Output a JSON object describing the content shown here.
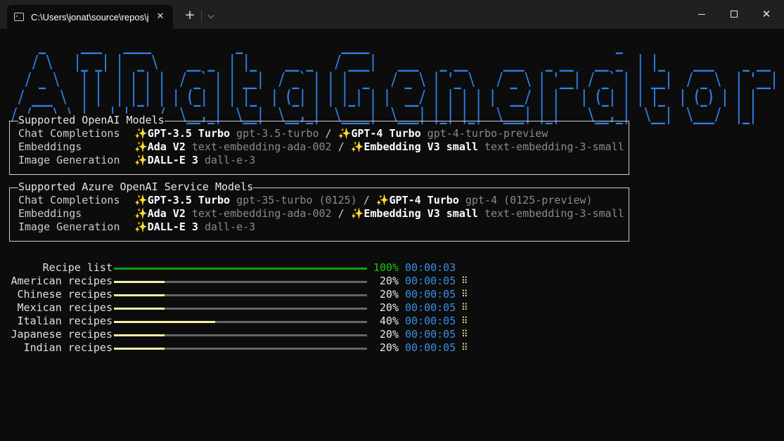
{
  "window": {
    "tab_title": "C:\\Users\\jonat\\source\\repos\\j",
    "tab_icon": "terminal-icon",
    "close_glyph": "✕",
    "new_tab_glyph": "+",
    "dropdown_glyph": "⌵",
    "min_glyph": "",
    "max_glyph": "",
    "win_close_glyph": "✕"
  },
  "banner": {
    "ascii": "    _     ___   ____            _              ____                                   _                 \n   / \\   |_ _| |  _ \\    __ _  | |_    __ _   / ___|   ___   _ __     ___   _ __   __ _  | |_    ___    _ __ \n  / _ \\   | |  | | | |  / _` | | __|  / _` | | |  _   / _ \\ | '_ \\   / _ \\ | '__| / _` | | __|  / _ \\  | '__|\n / ___ \\  | |  | |_| | | (_| | | |_  | (_| | | |_| | |  __/ | | | | |  __/ | |   | (_| | | |_  | (_) | | |   \n/_/   \\_\\ |___| |____/  \\__,_|  \\__|  \\__,_|  \\____|  \\___| |_| |_|  \\___| |_|    \\__,_|  \\__|  \\___/  |_|   ",
    "color": "#2f7fe6"
  },
  "openai_panel": {
    "title": "Supported OpenAI Models",
    "rows": [
      {
        "label": "Chat Completions",
        "items": [
          {
            "icon": "✨",
            "name": "GPT-3.5 Turbo",
            "id": "gpt-3.5-turbo"
          },
          {
            "icon": "✨",
            "name": "GPT-4 Turbo",
            "id": "gpt-4-turbo-preview"
          }
        ]
      },
      {
        "label": "Embeddings",
        "items": [
          {
            "icon": "✨",
            "name": "Ada V2",
            "id": "text-embedding-ada-002"
          },
          {
            "icon": "✨",
            "name": "Embedding V3 small",
            "id": "text-embedding-3-small"
          }
        ]
      },
      {
        "label": "Image Generation",
        "items": [
          {
            "icon": "✨",
            "name": "DALL-E 3",
            "id": "dall-e-3"
          }
        ]
      }
    ]
  },
  "azure_panel": {
    "title": "Supported Azure OpenAI Service Models",
    "rows": [
      {
        "label": "Chat Completions",
        "items": [
          {
            "icon": "✨",
            "name": "GPT-3.5 Turbo",
            "id": "gpt-35-turbo (0125)"
          },
          {
            "icon": "✨",
            "name": "GPT-4 Turbo",
            "id": "gpt-4 (0125-preview)"
          }
        ]
      },
      {
        "label": "Embeddings",
        "items": [
          {
            "icon": "✨",
            "name": "Ada V2",
            "id": "text-embedding-ada-002"
          },
          {
            "icon": "✨",
            "name": "Embedding V3 small",
            "id": "text-embedding-3-small"
          }
        ]
      },
      {
        "label": "Image Generation",
        "items": [
          {
            "icon": "✨",
            "name": "DALL-E 3",
            "id": "dall-e-3"
          }
        ]
      }
    ]
  },
  "separator": " / ",
  "progress": [
    {
      "label": "Recipe list",
      "percent": 100,
      "pct_text": "100%",
      "time": "00:00:03",
      "spinner": "",
      "color": "#13a10e",
      "pct_color": "#16c60c"
    },
    {
      "label": "American recipes",
      "percent": 20,
      "pct_text": "20%",
      "time": "00:00:05",
      "spinner": "⠿",
      "color": "#f9f1a5",
      "pct_color": "#e8e8e8"
    },
    {
      "label": "Chinese recipes",
      "percent": 20,
      "pct_text": "20%",
      "time": "00:00:05",
      "spinner": "⠿",
      "color": "#f9f1a5",
      "pct_color": "#e8e8e8"
    },
    {
      "label": "Mexican recipes",
      "percent": 20,
      "pct_text": "20%",
      "time": "00:00:05",
      "spinner": "⠿",
      "color": "#f9f1a5",
      "pct_color": "#e8e8e8"
    },
    {
      "label": "Italian recipes",
      "percent": 40,
      "pct_text": "40%",
      "time": "00:00:05",
      "spinner": "⠿",
      "color": "#f9f1a5",
      "pct_color": "#e8e8e8"
    },
    {
      "label": "Japanese recipes",
      "percent": 20,
      "pct_text": "20%",
      "time": "00:00:05",
      "spinner": "⠿",
      "color": "#f9f1a5",
      "pct_color": "#e8e8e8"
    },
    {
      "label": "Indian recipes",
      "percent": 20,
      "pct_text": "20%",
      "time": "00:00:05",
      "spinner": "⠿",
      "color": "#f9f1a5",
      "pct_color": "#e8e8e8"
    }
  ]
}
